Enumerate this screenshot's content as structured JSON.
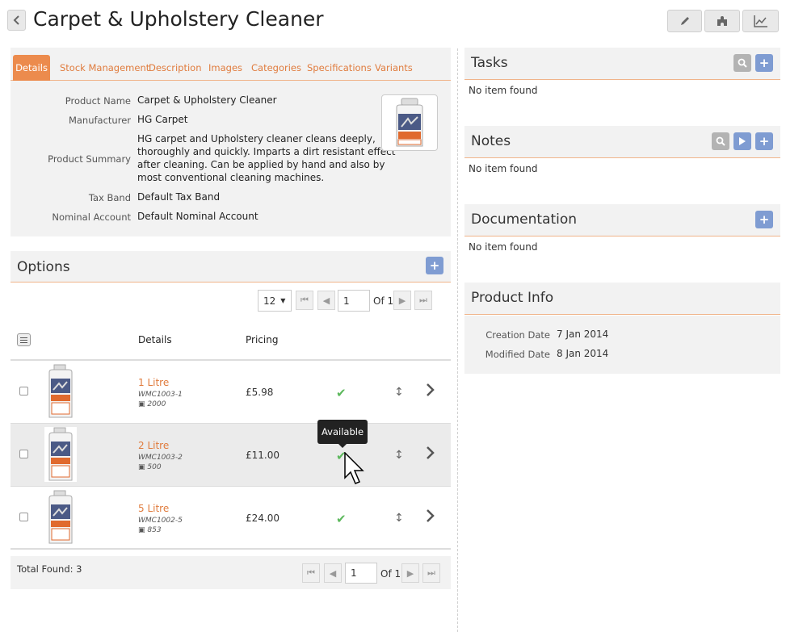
{
  "page": {
    "title": "Carpet & Upholstery Cleaner"
  },
  "tabs": [
    "Details",
    "Stock Management",
    "Description",
    "Images",
    "Categories",
    "Specifications",
    "Variants"
  ],
  "details": {
    "product_name_label": "Product Name",
    "product_name": "Carpet & Upholstery Cleaner",
    "manufacturer_label": "Manufacturer",
    "manufacturer": "HG Carpet",
    "summary_label": "Product Summary",
    "summary_lines": [
      "HG carpet and Upholstery cleaner cleans deeply,",
      "thoroughly and quickly. Imparts a dirt resistant effect",
      "after cleaning. Can be applied by hand and also by",
      "most conventional cleaning machines."
    ],
    "tax_band_label": "Tax Band",
    "tax_band": "Default Tax Band",
    "nominal_label": "Nominal Account",
    "nominal": "Default Nominal Account"
  },
  "options": {
    "title": "Options",
    "per_page": "12",
    "page": "1",
    "of_label": "Of 1",
    "col_details": "Details",
    "col_pricing": "Pricing",
    "rows": [
      {
        "name": "1 Litre",
        "sku": "WMC1003-1",
        "stock": "2000",
        "price": "£5.98"
      },
      {
        "name": "2 Litre",
        "sku": "WMC1003-2",
        "stock": "500",
        "price": "£11.00"
      },
      {
        "name": "5 Litre",
        "sku": "WMC1002-5",
        "stock": "853",
        "price": "£24.00"
      }
    ],
    "tooltip": "Available",
    "total_label": "Total Found:",
    "total": "3",
    "footer_page": "1",
    "footer_of": "Of 1"
  },
  "tasks": {
    "title": "Tasks",
    "empty": "No item found"
  },
  "notes": {
    "title": "Notes",
    "empty": "No item found"
  },
  "documentation": {
    "title": "Documentation",
    "empty": "No item found"
  },
  "product_info": {
    "title": "Product Info",
    "creation_label": "Creation Date",
    "creation": "7 Jan 2014",
    "modified_label": "Modified Date",
    "modified": "8 Jan 2014"
  },
  "colors": {
    "accent": "#e07c3e",
    "blue_button": "#7f9cd2",
    "check": "#5cb85c"
  },
  "icons": [
    "back-icon",
    "pencil-icon",
    "puzzle-icon",
    "chart-icon",
    "search-icon",
    "plus-icon",
    "play-icon",
    "menu-icon",
    "check-icon",
    "sort-icon",
    "chevron-right-icon"
  ]
}
